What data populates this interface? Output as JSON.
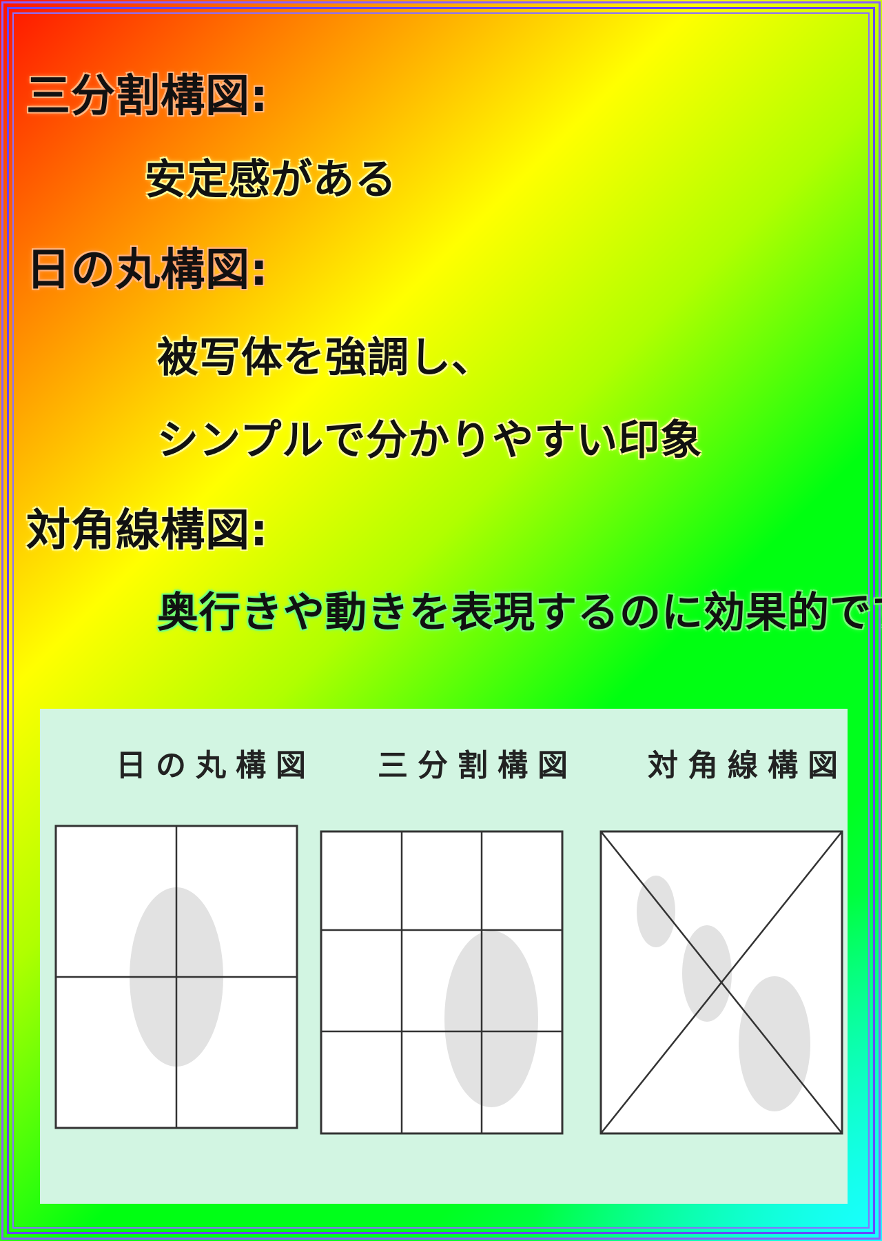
{
  "sections": [
    {
      "heading": "三分割構図:",
      "lines": [
        "安定感がある"
      ]
    },
    {
      "heading": "日の丸構図:",
      "lines": [
        "被写体を強調し、",
        "シンプルで分かりやすい印象"
      ]
    },
    {
      "heading": "対角線構図:",
      "lines": [
        "奥行きや動きを表現するのに効果的です"
      ]
    }
  ],
  "diagrams": [
    {
      "title": "日の丸構図",
      "type": "center-cross"
    },
    {
      "title": "三分割構図",
      "type": "thirds-grid"
    },
    {
      "title": "対角線構図",
      "type": "diagonal-x"
    }
  ],
  "colors": {
    "panel_background": "#d2f5e2",
    "subject_fill": "#e2e2e2",
    "frame_border": "#7b5cff"
  }
}
